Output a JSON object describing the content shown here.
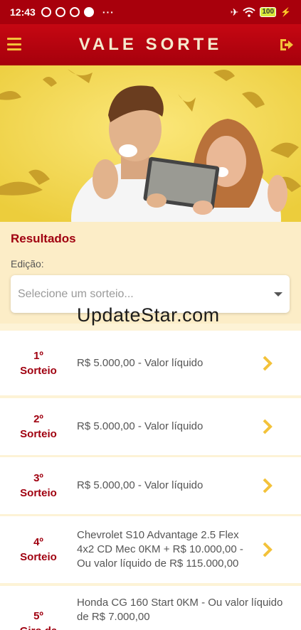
{
  "status_bar": {
    "time": "12:43",
    "dots": "···",
    "battery": "100"
  },
  "app_bar": {
    "title": "VALE SORTE"
  },
  "results": {
    "title": "Resultados",
    "edition_label": "Edição:",
    "select_placeholder": "Selecione um sorteio..."
  },
  "watermark": "UpdateStar.com",
  "draws": [
    {
      "line1": "1º",
      "line2": "Sorteio",
      "line3": "",
      "description": "R$ 5.000,00 - Valor líquido"
    },
    {
      "line1": "2º",
      "line2": "Sorteio",
      "line3": "",
      "description": "R$ 5.000,00 - Valor líquido"
    },
    {
      "line1": "3º",
      "line2": "Sorteio",
      "line3": "",
      "description": "R$ 5.000,00 - Valor líquido"
    },
    {
      "line1": "4º",
      "line2": "Sorteio",
      "line3": "",
      "description": "Chevrolet S10 Advantage 2.5 Flex 4x2 CD Mec 0KM + R$ 10.000,00 - Ou valor líquido de R$ 115.000,00"
    },
    {
      "line1": "5º",
      "line2": "Giro da",
      "line3": "",
      "description": "Honda CG 160 Start 0KM - Ou valor líquido de R$ 7.000,00"
    }
  ],
  "colors": {
    "primary_red": "#a8000c",
    "accent_gold": "#f3c23a",
    "cream": "#fcedc7"
  }
}
